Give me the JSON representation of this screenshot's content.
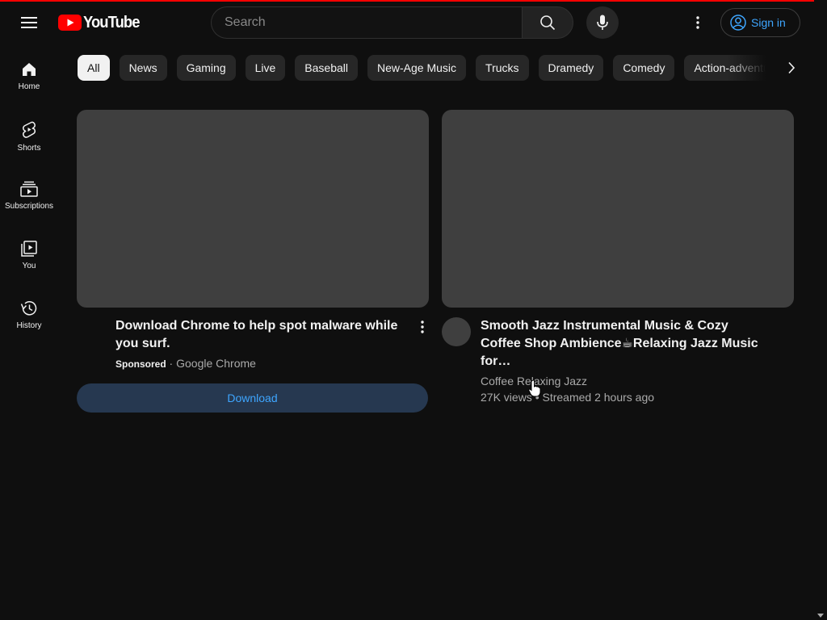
{
  "header": {
    "logo_text": "YouTube",
    "search_placeholder": "Search",
    "signin_label": "Sign in"
  },
  "sidebar": {
    "items": [
      {
        "label": "Home",
        "icon": "home-icon"
      },
      {
        "label": "Shorts",
        "icon": "shorts-icon"
      },
      {
        "label": "Subscriptions",
        "icon": "subscriptions-icon"
      },
      {
        "label": "You",
        "icon": "you-icon"
      },
      {
        "label": "History",
        "icon": "history-icon"
      }
    ]
  },
  "chips": [
    "All",
    "News",
    "Gaming",
    "Live",
    "Baseball",
    "New-Age Music",
    "Trucks",
    "Dramedy",
    "Comedy",
    "Action-adventure"
  ],
  "ad_card": {
    "title": "Download Chrome to help spot malware while you surf.",
    "sponsored": "Sponsored",
    "advertiser": "Google Chrome",
    "cta": "Download"
  },
  "video_card": {
    "title": "Smooth Jazz Instrumental Music & Cozy Coffee Shop Ambience☕Relaxing Jazz Music for…",
    "channel": "Coffee Relaxing Jazz",
    "views": "27K views",
    "age": "Streamed 2 hours ago"
  },
  "colors": {
    "background": "#0f0f0f",
    "accent_red": "#ff0000",
    "link_blue": "#3ea6ff",
    "chip_bg": "#272727",
    "thumb_placeholder": "#3f3f3f"
  }
}
